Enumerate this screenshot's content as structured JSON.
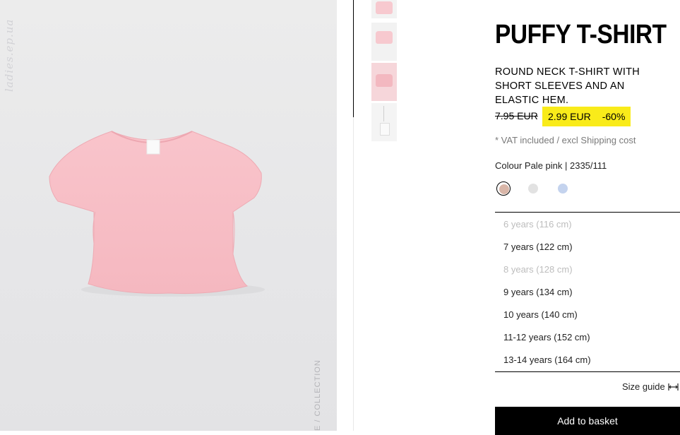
{
  "gallery": {
    "watermark": "ladies.ep.ua",
    "side_label": "E / COLLECTION",
    "thumbnails": [
      "thumb-1",
      "thumb-2",
      "thumb-3",
      "thumb-4"
    ]
  },
  "product": {
    "title": "PUFFY T-SHIRT",
    "description": "ROUND NECK T-SHIRT WITH SHORT SLEEVES AND AN ELASTIC HEM.",
    "old_price": "7.95 EUR",
    "sale_price": "2.99 EUR",
    "discount": "-60%",
    "vat_note": "* VAT included / excl Shipping cost",
    "colour_line": "Colour Pale pink | 2335/111",
    "swatches": [
      {
        "name": "pale-pink",
        "color": "#d9b6a8",
        "selected": true
      },
      {
        "name": "light-grey",
        "color": "#e2e2e2",
        "selected": false
      },
      {
        "name": "light-blue",
        "color": "#c4d3ee",
        "selected": false
      }
    ],
    "sizes": [
      {
        "label": "6 years (116 cm)",
        "available": false
      },
      {
        "label": "7 years (122 cm)",
        "available": true
      },
      {
        "label": "8 years (128 cm)",
        "available": false
      },
      {
        "label": "9 years (134 cm)",
        "available": true
      },
      {
        "label": "10 years (140 cm)",
        "available": true
      },
      {
        "label": "11-12 years (152 cm)",
        "available": true
      },
      {
        "label": "13-14 years (164 cm)",
        "available": true
      }
    ],
    "size_guide": "Size guide",
    "add_button": "Add to basket",
    "colors": {
      "sale_highlight": "#f9eb1a",
      "button": "#000000",
      "unavailable": "#bdbdbd"
    }
  }
}
